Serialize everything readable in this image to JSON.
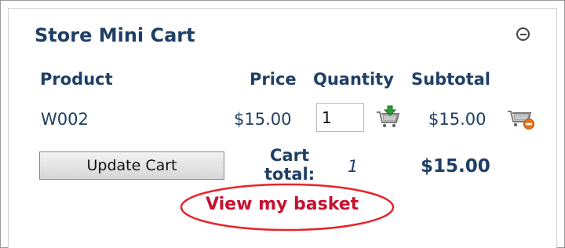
{
  "mini_cart": {
    "title": "Store Mini Cart",
    "collapse_icon": "collapse-circle-minus-icon",
    "columns": {
      "product": "Product",
      "price": "Price",
      "quantity": "Quantity",
      "subtotal": "Subtotal"
    },
    "items": [
      {
        "product": "W002",
        "price": "$15.00",
        "quantity": "1",
        "subtotal": "$15.00",
        "update_icon": "cart-add-icon",
        "remove_icon": "cart-remove-icon"
      }
    ],
    "update_button_label": "Update Cart",
    "cart_total_label": "Cart total:",
    "total_quantity": "1",
    "total_amount": "$15.00",
    "view_basket_link": "View my basket"
  },
  "colors": {
    "heading": "#1f3f66",
    "link": "#c8102e",
    "annotation": "#e8232a"
  }
}
